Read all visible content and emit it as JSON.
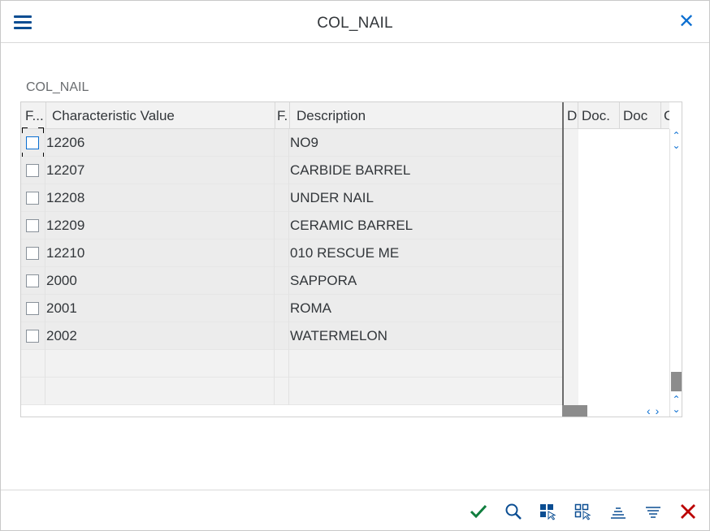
{
  "window": {
    "title": "COL_NAIL"
  },
  "section_label": "COL_NAIL",
  "table": {
    "left_columns": [
      "F...",
      "Characteristic Value",
      "F.",
      "Description"
    ],
    "right_columns": [
      "D",
      "Doc.",
      "Doc",
      "C"
    ],
    "rows": [
      {
        "value": "12206",
        "description": "NO9"
      },
      {
        "value": "12207",
        "description": "CARBIDE BARREL"
      },
      {
        "value": "12208",
        "description": "UNDER NAIL"
      },
      {
        "value": "12209",
        "description": "CERAMIC BARREL"
      },
      {
        "value": "12210",
        "description": "010 RESCUE ME"
      },
      {
        "value": "2000",
        "description": "SAPPORA"
      },
      {
        "value": "2001",
        "description": "ROMA"
      },
      {
        "value": "2002",
        "description": "WATERMELON"
      }
    ]
  },
  "footer_icons": [
    "checkmark-icon",
    "search-icon",
    "select-all-icon",
    "deselect-all-icon",
    "sort-ascending-icon",
    "filter-icon",
    "cancel-icon"
  ],
  "colors": {
    "accent": "#0a6ed1",
    "confirm": "#107e3e",
    "cancel": "#bb0000",
    "header_blue": "#0a4d92"
  }
}
